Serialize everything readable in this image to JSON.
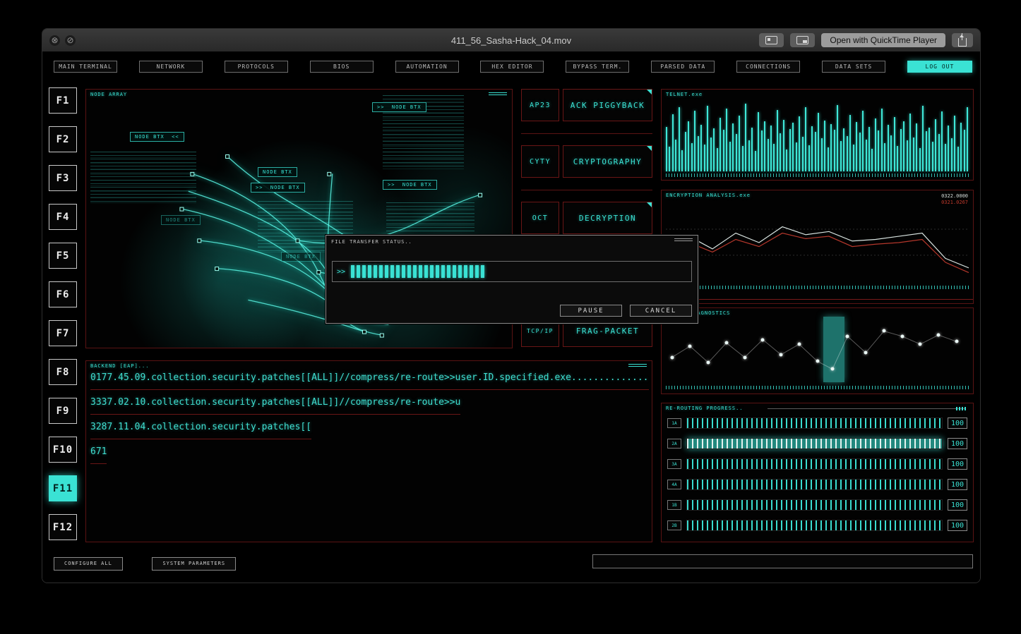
{
  "titlebar": {
    "title": "411_56_Sasha-Hack_04.mov",
    "open_with_label": "Open with QuickTime Player",
    "icons": {
      "close": "⊗",
      "prohibit": "⊘"
    }
  },
  "nav": {
    "tabs": [
      "MAIN TERMINAL",
      "NETWORK",
      "PROTOCOLS",
      "BIOS",
      "AUTOMATION",
      "HEX EDITOR",
      "BYPASS TERM.",
      "PARSED DATA",
      "CONNECTIONS",
      "DATA SETS"
    ],
    "logout": "LOG OUT"
  },
  "fkeys": {
    "keys": [
      "F1",
      "F2",
      "F3",
      "F4",
      "F5",
      "F6",
      "F7",
      "F8",
      "F9",
      "F10",
      "F11",
      "F12"
    ],
    "active": "F11"
  },
  "node_array": {
    "title": "NODE ARRAY",
    "tags": [
      ">>  NODE BTX",
      "NODE BTX  <<",
      "NODE BTX",
      ">>  NODE BTX",
      ">>  NODE BTX",
      "NODE BTX",
      "NODE BTX"
    ]
  },
  "modules": [
    {
      "code": "AP23",
      "label": "ACK PIGGYBACK"
    },
    {
      "code": "CYTY",
      "label": "CRYPTOGRAPHY"
    },
    {
      "code": "OCT",
      "label": "DECRYPTION"
    },
    {
      "code": "TCP/IP",
      "label": "FRAG-PACKET"
    }
  ],
  "file_transfer": {
    "title": "FILE TRANSFER STATUS..",
    "prompt": ">>",
    "segments_filled": 24,
    "segments_total": 56,
    "pause_label": "PAUSE",
    "cancel_label": "CANCEL"
  },
  "telnet": {
    "title": "TELNET.exe",
    "bars": [
      62,
      35,
      80,
      45,
      90,
      30,
      55,
      70,
      40,
      85,
      50,
      65,
      38,
      92,
      48,
      60,
      33,
      75,
      58,
      88,
      42,
      67,
      52,
      78,
      36,
      95,
      44,
      61,
      29,
      83,
      57,
      70,
      46,
      64,
      39,
      86,
      53,
      72,
      31,
      59,
      68,
      41,
      77,
      49,
      90,
      37,
      63,
      55,
      82,
      47,
      71,
      34,
      66,
      58,
      93,
      43,
      60,
      50,
      79,
      38,
      69,
      54,
      85,
      45,
      62,
      32,
      74,
      57,
      88,
      40,
      65,
      51,
      76,
      36,
      59,
      70,
      44,
      81,
      48,
      67,
      33,
      92,
      56,
      61,
      42,
      73,
      52,
      84,
      39,
      64,
      47,
      78,
      35,
      68,
      58,
      90
    ]
  },
  "encryption": {
    "title": "ENCRYPTION ANALYSIS.exe",
    "readout_primary": "0322.0000",
    "readout_secondary": "0321.0267",
    "white": [
      52,
      42,
      58,
      38,
      50,
      30,
      40,
      36,
      48,
      46,
      42,
      38,
      70,
      82
    ],
    "red": [
      58,
      50,
      62,
      46,
      55,
      38,
      45,
      42,
      55,
      52,
      50,
      46,
      75,
      88
    ]
  },
  "diagnostics": {
    "title": "DIAGNOSTICS",
    "points": [
      [
        2,
        62
      ],
      [
        8,
        45
      ],
      [
        14,
        70
      ],
      [
        20,
        40
      ],
      [
        26,
        62
      ],
      [
        32,
        35
      ],
      [
        38,
        58
      ],
      [
        44,
        42
      ],
      [
        50,
        68
      ],
      [
        55,
        80
      ],
      [
        60,
        30
      ],
      [
        66,
        55
      ],
      [
        72,
        22
      ],
      [
        78,
        30
      ],
      [
        84,
        42
      ],
      [
        90,
        28
      ],
      [
        96,
        38
      ]
    ],
    "highlight_band": {
      "left_pct": 52,
      "width_pct": 7
    }
  },
  "rerouting": {
    "title": "RE-ROUTING PROGRESS..",
    "rows": [
      {
        "label": "1A",
        "value": "100"
      },
      {
        "label": "2A",
        "value": "100",
        "active": true
      },
      {
        "label": "3A",
        "value": "100"
      },
      {
        "label": "4A",
        "value": "100"
      },
      {
        "label": "1B",
        "value": "100"
      },
      {
        "label": "2B",
        "value": "100"
      }
    ]
  },
  "backend": {
    "title": "BACKEND [EAP]...",
    "lines": [
      "0177.45.09.collection.security.patches[[ALL]]//compress/re-route>>user.ID.specified.exe..............",
      "3337.02.10.collection.security.patches[[ALL]]//compress/re-route>>u",
      "3287.11.04.collection.security.patches[[",
      "671"
    ]
  },
  "footer": {
    "configure_label": "CONFIGURE ALL",
    "system_label": "SYSTEM PARAMETERS",
    "command_value": ""
  },
  "colors": {
    "accent": "#3ae2d4",
    "alert": "#7a1a1a"
  }
}
